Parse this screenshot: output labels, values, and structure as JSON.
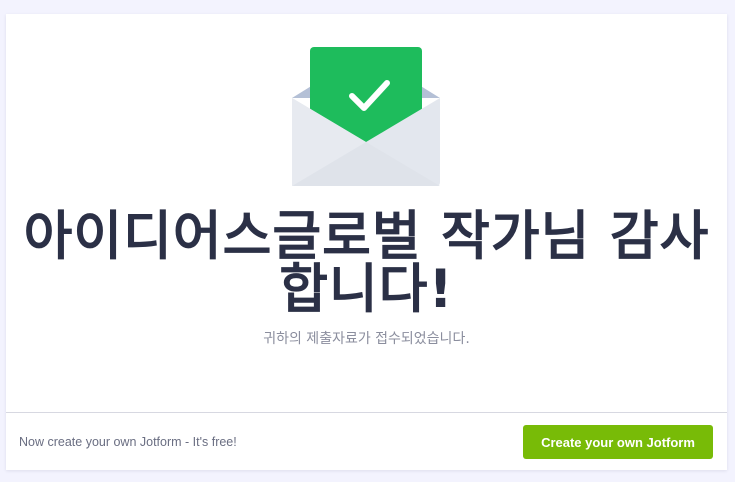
{
  "confirmation": {
    "heading": "아이디어스글로벌 작가님 감사 합니다!",
    "message": "귀하의 제출자료가 접수되었습니다."
  },
  "footer": {
    "promo_text": "Now create your own Jotform - It's free!",
    "cta_label": "Create your own Jotform"
  },
  "icons": {
    "envelope": "envelope-check-icon"
  },
  "colors": {
    "check_green": "#1ebc5c",
    "cta_green": "#78bb07",
    "heading": "#2b3046",
    "page_background": "#f3f3fe"
  }
}
